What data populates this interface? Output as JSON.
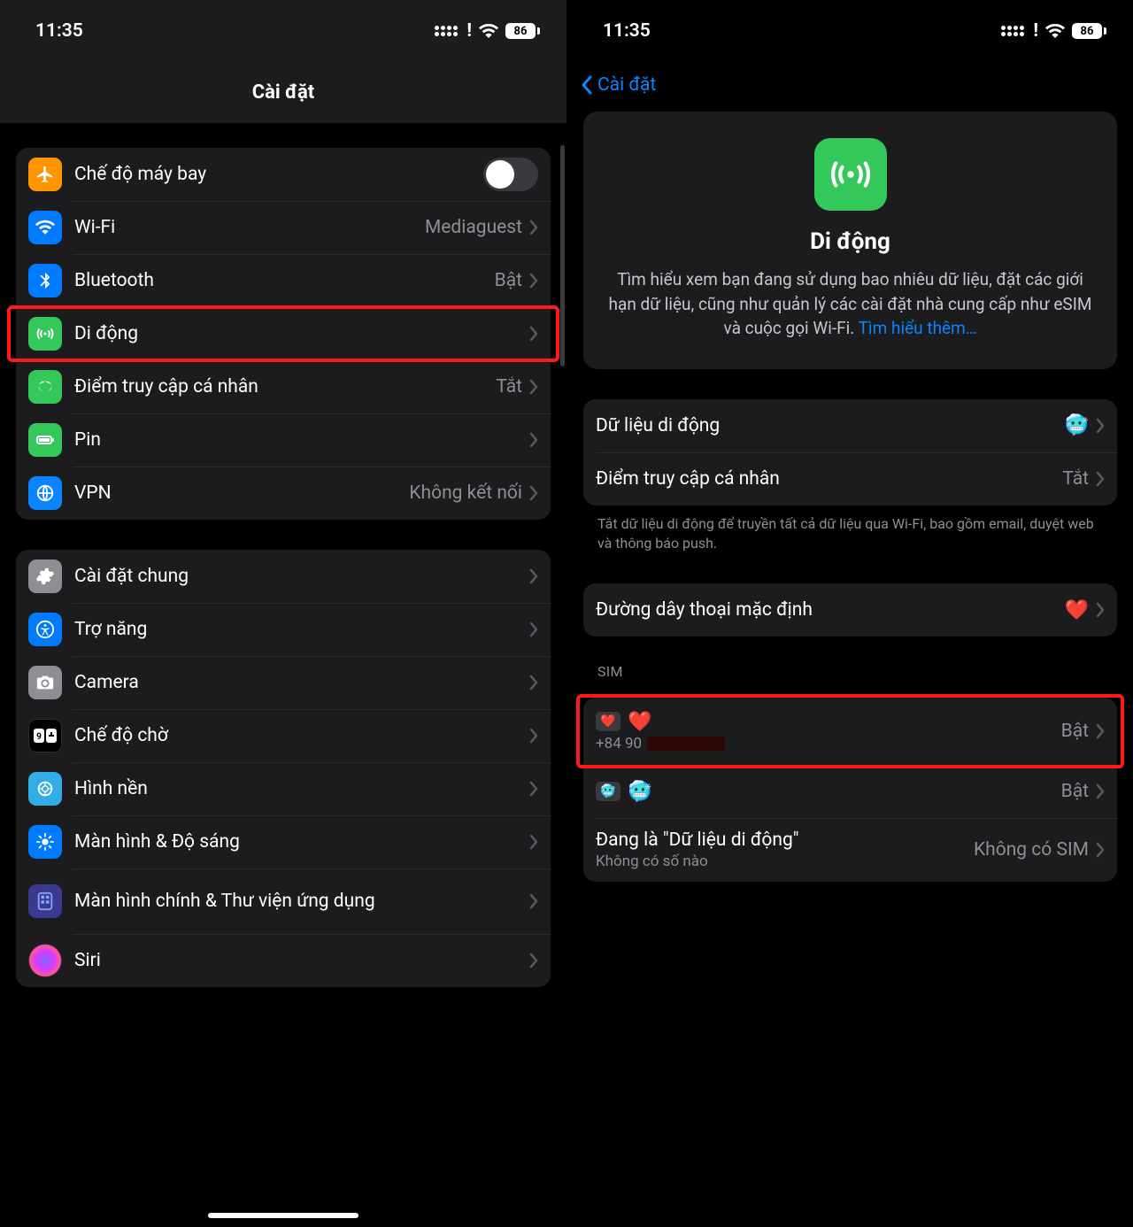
{
  "status": {
    "time": "11:35",
    "battery": "86"
  },
  "screen1": {
    "title": "Cài đặt",
    "group1": {
      "airplane": "Chế độ máy bay",
      "wifi": "Wi-Fi",
      "wifi_val": "Mediaguest",
      "bt": "Bluetooth",
      "bt_val": "Bật",
      "cellular": "Di động",
      "hotspot": "Điểm truy cập cá nhân",
      "hotspot_val": "Tắt",
      "battery": "Pin",
      "vpn": "VPN",
      "vpn_val": "Không kết nối"
    },
    "group2": {
      "general": "Cài đặt chung",
      "accessibility": "Trợ năng",
      "camera": "Camera",
      "standby": "Chế độ chờ",
      "wallpaper": "Hình nền",
      "display": "Màn hình & Độ sáng",
      "homescreen": "Màn hình chính & Thư viện ứng dụng",
      "siri": "Siri"
    }
  },
  "screen2": {
    "back": "Cài đặt",
    "hero_title": "Di động",
    "hero_desc": "Tìm hiểu xem bạn đang sử dụng bao nhiêu dữ liệu, đặt các giới hạn dữ liệu, cũng như quản lý các cài đặt nhà cung cấp như eSIM và cuộc gọi Wi-Fi. ",
    "hero_link": "Tìm hiểu thêm…",
    "g1": {
      "data": "Dữ liệu di động",
      "data_val": "🥶",
      "hotspot": "Điểm truy cập cá nhân",
      "hotspot_val": "Tắt"
    },
    "note1": "Tắt dữ liệu di động để truyền tất cả dữ liệu qua Wi-Fi, bao gồm email, duyệt web và thông báo push.",
    "g2": {
      "default_line": "Đường dây thoại mặc định",
      "default_val": "❤️"
    },
    "sim_header": "SIM",
    "sim1": {
      "tag": "❤️",
      "name": "❤️",
      "sub_prefix": "+84 90",
      "val": "Bật"
    },
    "sim2": {
      "tag": "🥶",
      "name": "🥶",
      "val": "Bật"
    },
    "sim3": {
      "name": "Đang là \"Dữ liệu di động\"",
      "sub": "Không có số nào",
      "val": "Không có SIM"
    }
  }
}
